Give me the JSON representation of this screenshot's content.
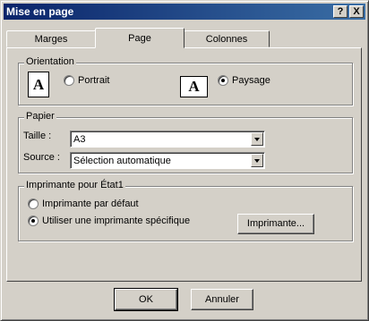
{
  "window": {
    "title": "Mise en page",
    "help_glyph": "?",
    "close_glyph": "X"
  },
  "tabs": [
    "Marges",
    "Page",
    "Colonnes"
  ],
  "orientation": {
    "legend": "Orientation",
    "portrait_label": "Portrait",
    "landscape_label": "Paysage",
    "selected": "Paysage",
    "portrait_icon_letter": "A",
    "landscape_icon_letter": "A"
  },
  "paper": {
    "legend": "Papier",
    "size_label": "Taille :",
    "size_value": "A3",
    "source_label": "Source :",
    "source_value": "Sélection automatique"
  },
  "printer": {
    "legend": "Imprimante pour État1",
    "default_label": "Imprimante par défaut",
    "specific_label": "Utiliser une imprimante spécifique",
    "selected": "specific",
    "printer_button": "Imprimante..."
  },
  "footer": {
    "ok": "OK",
    "cancel": "Annuler"
  }
}
